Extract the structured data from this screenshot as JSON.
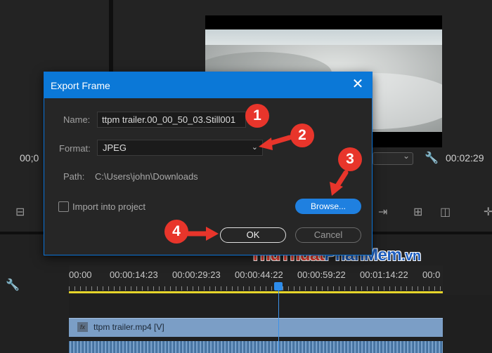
{
  "background": {
    "left_timecode": "00;0",
    "right_timecode": "00:02:29"
  },
  "timeline": {
    "ruler_labels": [
      "00:00",
      "00:00:14:23",
      "00:00:29:23",
      "00:00:44:22",
      "00:00:59:22",
      "00:01:14:22",
      "00:0"
    ],
    "video_clip_label": "ttpm trailer.mp4 [V]",
    "fx_badge": "fx",
    "clip_color": "#7b9ec6",
    "work_area_color": "#e6d52a",
    "playhead_color": "#2d8ceb"
  },
  "watermark": {
    "part1": "Thu",
    "part2": "Thuat",
    "part3": "PhanMem",
    "part4": ".vn"
  },
  "dialog": {
    "title": "Export Frame",
    "close_glyph": "✕",
    "name_label": "Name:",
    "name_value": "ttpm trailer.00_00_50_03.Still001",
    "format_label": "Format:",
    "format_value": "JPEG",
    "path_label": "Path:",
    "path_value": "C:\\Users\\john\\Downloads",
    "import_label": "Import into project",
    "import_checked": false,
    "browse_label": "Browse...",
    "ok_label": "OK",
    "cancel_label": "Cancel",
    "accent_color": "#0b78d7"
  },
  "annotations": {
    "step1": "1",
    "step2": "2",
    "step3": "3",
    "step4": "4",
    "color": "#e8352b"
  }
}
